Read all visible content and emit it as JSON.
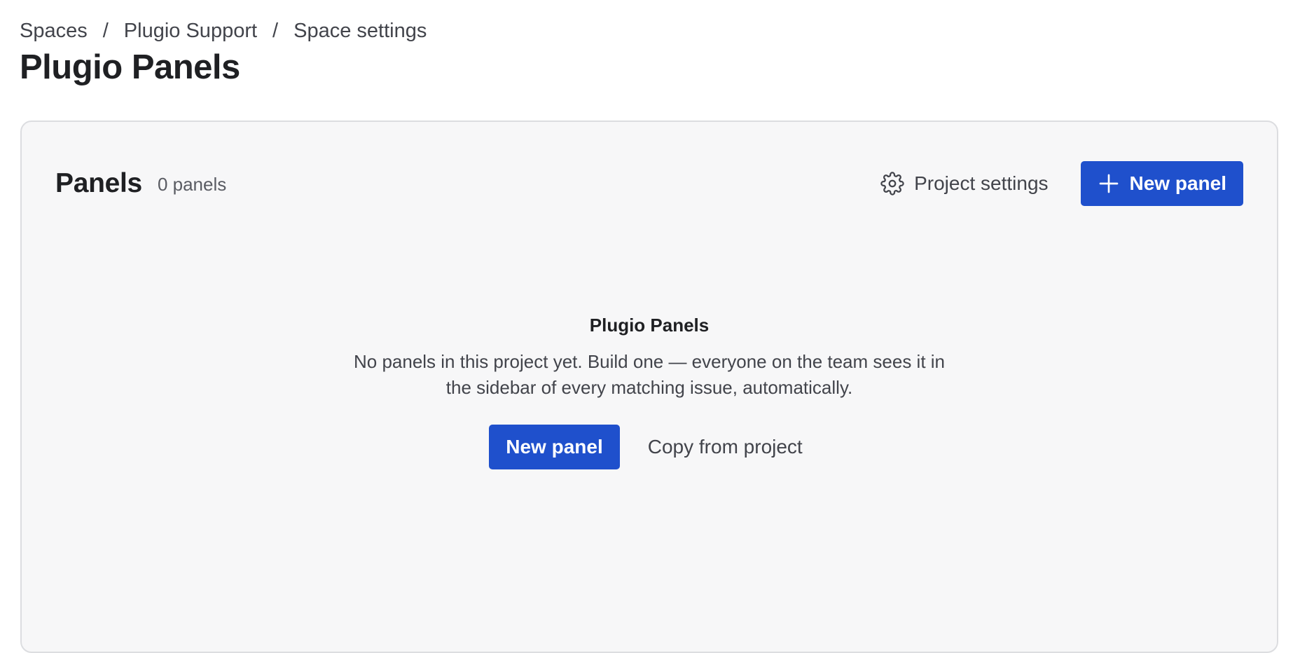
{
  "breadcrumb": {
    "items": [
      "Spaces",
      "Plugio Support",
      "Space settings"
    ],
    "separator": "/"
  },
  "page": {
    "title": "Plugio Panels"
  },
  "panels_card": {
    "title": "Panels",
    "count": "0 panels",
    "project_settings_label": "Project settings",
    "project_settings_icon": "gear-icon",
    "new_panel_label": "New panel",
    "new_panel_icon": "plus-icon"
  },
  "empty_state": {
    "title": "Plugio Panels",
    "description": "No panels in this project yet. Build one — everyone on the team sees it in the sidebar of every matching issue, automatically.",
    "new_panel_label": "New panel",
    "copy_label": "Copy from project"
  },
  "colors": {
    "primary": "#1f50cc",
    "card_background": "#f7f7f8",
    "card_border": "#dcdde0",
    "text": "#292a2e"
  }
}
